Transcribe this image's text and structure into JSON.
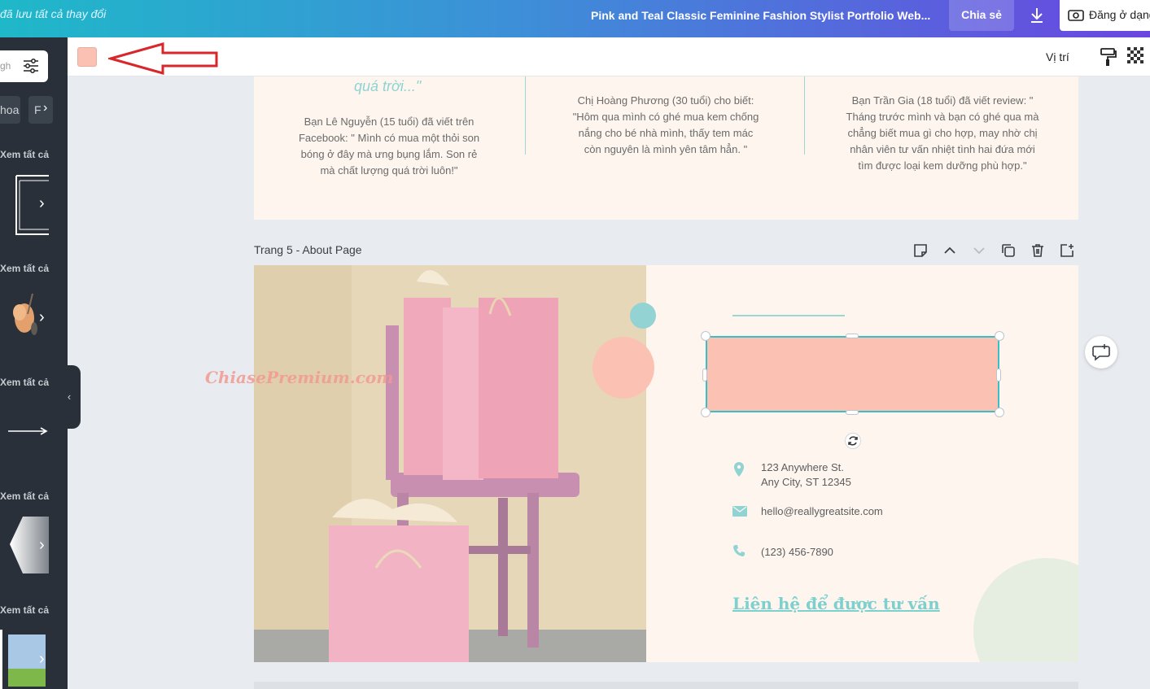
{
  "topbar": {
    "saved_status": "đã lưu tất cả thay đổi",
    "document_title": "Pink and Teal Classic Feminine Fashion Stylist Portfolio Web...",
    "share_label": "Chia sẻ",
    "publish_label": "Đăng ở dạng"
  },
  "left_panel": {
    "search_placeholder": "gh",
    "chips": [
      "hoa",
      "F"
    ],
    "see_all": "Xem tất cả"
  },
  "toolbar": {
    "fill_color": "#FBC2B3",
    "position_label": "Vị trí"
  },
  "page4": {
    "quote_tail": "quá trời...\"",
    "col1": "Bạn Lê Nguyễn (15 tuổi) đã viết trên Facebook: \" Mình có mua một thỏi son bóng ở đây mà ưng bụng lắm. Son rẻ mà chất lượng quá trời luôn!\"",
    "col2": "Chị Hoàng Phương (30 tuổi) cho biết: \"Hôm qua mình có ghé mua kem chống nắng cho bé nhà mình, thấy tem mác còn nguyên là mình yên tâm hẳn. \"",
    "col3": "Bạn Trần Gia (18 tuổi) đã viết review: \" Tháng trước mình và bạn có ghé qua mà chẳng biết mua gì cho hợp, may nhờ chị nhân viên tư vấn nhiệt tình hai đứa mới tìm được loại kem dưỡng phù hợp.\""
  },
  "page5": {
    "label": "Trang 5 - About Page",
    "address_line1": "123 Anywhere St.",
    "address_line2": "Any City, ST 12345",
    "email": "hello@reallygreatsite.com",
    "phone": "(123) 456-7890",
    "cta": "Liên hệ để được tư vấn"
  },
  "watermark": "ChiasePremium.com",
  "colors": {
    "accent_teal": "#37C0C8",
    "shape_pink": "#FBC2B3",
    "page_bg": "#FDF5EE"
  }
}
